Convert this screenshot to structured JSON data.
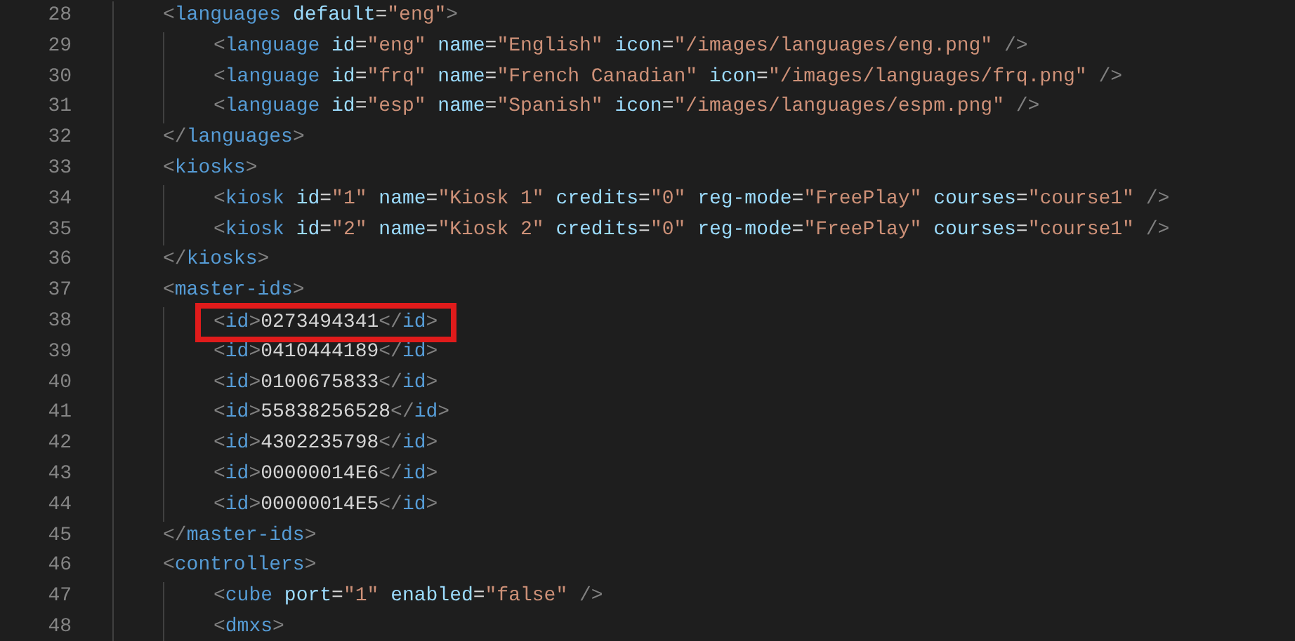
{
  "editor": {
    "lines": [
      {
        "number": "28",
        "highlighted": false,
        "tokens": [
          {
            "kind": "open",
            "text": "<"
          },
          {
            "kind": "tag",
            "text": "languages"
          },
          {
            "kind": "attr",
            "text": "default"
          },
          {
            "kind": "eq",
            "text": "="
          },
          {
            "kind": "value",
            "text": "\"eng\""
          },
          {
            "kind": "punct",
            "text": ">"
          }
        ],
        "children": [
          {
            "number": "29",
            "highlighted": false,
            "tokens": [
              {
                "kind": "open",
                "text": "<"
              },
              {
                "kind": "tag",
                "text": "language"
              },
              {
                "kind": "attr",
                "text": "id"
              },
              {
                "kind": "eq",
                "text": "="
              },
              {
                "kind": "value",
                "text": "\"eng\""
              },
              {
                "kind": "attr",
                "text": "name"
              },
              {
                "kind": "eq",
                "text": "="
              },
              {
                "kind": "value",
                "text": "\"English\""
              },
              {
                "kind": "attr",
                "text": "icon"
              },
              {
                "kind": "eq",
                "text": "="
              },
              {
                "kind": "value",
                "text": "\"/images/languages/eng.png\""
              },
              {
                "kind": "selfclose",
                "text": "/>"
              }
            ]
          },
          {
            "number": "30",
            "highlighted": false,
            "tokens": [
              {
                "kind": "open",
                "text": "<"
              },
              {
                "kind": "tag",
                "text": "language"
              },
              {
                "kind": "attr",
                "text": "id"
              },
              {
                "kind": "eq",
                "text": "="
              },
              {
                "kind": "value",
                "text": "\"frq\""
              },
              {
                "kind": "attr",
                "text": "name"
              },
              {
                "kind": "eq",
                "text": "="
              },
              {
                "kind": "value",
                "text": "\"French Canadian\""
              },
              {
                "kind": "attr",
                "text": "icon"
              },
              {
                "kind": "eq",
                "text": "="
              },
              {
                "kind": "value",
                "text": "\"/images/languages/frq.png\""
              },
              {
                "kind": "selfclose",
                "text": "/>"
              }
            ]
          },
          {
            "number": "31",
            "highlighted": false,
            "tokens": [
              {
                "kind": "open",
                "text": "<"
              },
              {
                "kind": "tag",
                "text": "language"
              },
              {
                "kind": "attr",
                "text": "id"
              },
              {
                "kind": "eq",
                "text": "="
              },
              {
                "kind": "value",
                "text": "\"esp\""
              },
              {
                "kind": "attr",
                "text": "name"
              },
              {
                "kind": "eq",
                "text": "="
              },
              {
                "kind": "value",
                "text": "\"Spanish\""
              },
              {
                "kind": "attr",
                "text": "icon"
              },
              {
                "kind": "eq",
                "text": "="
              },
              {
                "kind": "value",
                "text": "\"/images/languages/espm.png\""
              },
              {
                "kind": "selfclose",
                "text": "/>"
              }
            ]
          }
        ]
      },
      {
        "number": "32",
        "highlighted": false,
        "tokens": [
          {
            "kind": "open",
            "text": "</"
          },
          {
            "kind": "tag",
            "text": "languages"
          },
          {
            "kind": "punct",
            "text": ">"
          }
        ]
      },
      {
        "number": "33",
        "highlighted": false,
        "tokens": [
          {
            "kind": "open",
            "text": "<"
          },
          {
            "kind": "tag",
            "text": "kiosks"
          },
          {
            "kind": "punct",
            "text": ">"
          }
        ],
        "children": [
          {
            "number": "34",
            "highlighted": false,
            "tokens": [
              {
                "kind": "open",
                "text": "<"
              },
              {
                "kind": "tag",
                "text": "kiosk"
              },
              {
                "kind": "attr",
                "text": "id"
              },
              {
                "kind": "eq",
                "text": "="
              },
              {
                "kind": "value",
                "text": "\"1\""
              },
              {
                "kind": "attr",
                "text": "name"
              },
              {
                "kind": "eq",
                "text": "="
              },
              {
                "kind": "value",
                "text": "\"Kiosk 1\""
              },
              {
                "kind": "attr",
                "text": "credits"
              },
              {
                "kind": "eq",
                "text": "="
              },
              {
                "kind": "value",
                "text": "\"0\""
              },
              {
                "kind": "attr",
                "text": "reg-mode"
              },
              {
                "kind": "eq",
                "text": "="
              },
              {
                "kind": "value",
                "text": "\"FreePlay\""
              },
              {
                "kind": "attr",
                "text": "courses"
              },
              {
                "kind": "eq",
                "text": "="
              },
              {
                "kind": "value",
                "text": "\"course1\""
              },
              {
                "kind": "selfclose",
                "text": "/>"
              }
            ]
          },
          {
            "number": "35",
            "highlighted": false,
            "tokens": [
              {
                "kind": "open",
                "text": "<"
              },
              {
                "kind": "tag",
                "text": "kiosk"
              },
              {
                "kind": "attr",
                "text": "id"
              },
              {
                "kind": "eq",
                "text": "="
              },
              {
                "kind": "value",
                "text": "\"2\""
              },
              {
                "kind": "attr",
                "text": "name"
              },
              {
                "kind": "eq",
                "text": "="
              },
              {
                "kind": "value",
                "text": "\"Kiosk 2\""
              },
              {
                "kind": "attr",
                "text": "credits"
              },
              {
                "kind": "eq",
                "text": "="
              },
              {
                "kind": "value",
                "text": "\"0\""
              },
              {
                "kind": "attr",
                "text": "reg-mode"
              },
              {
                "kind": "eq",
                "text": "="
              },
              {
                "kind": "value",
                "text": "\"FreePlay\""
              },
              {
                "kind": "attr",
                "text": "courses"
              },
              {
                "kind": "eq",
                "text": "="
              },
              {
                "kind": "value",
                "text": "\"course1\""
              },
              {
                "kind": "selfclose",
                "text": "/>"
              }
            ]
          }
        ]
      },
      {
        "number": "36",
        "highlighted": false,
        "tokens": [
          {
            "kind": "open",
            "text": "</"
          },
          {
            "kind": "tag",
            "text": "kiosks"
          },
          {
            "kind": "punct",
            "text": ">"
          }
        ]
      },
      {
        "number": "37",
        "highlighted": false,
        "tokens": [
          {
            "kind": "open",
            "text": "<"
          },
          {
            "kind": "tag",
            "text": "master-ids"
          },
          {
            "kind": "punct",
            "text": ">"
          }
        ],
        "children": [
          {
            "number": "38",
            "highlighted": true,
            "tokens": [
              {
                "kind": "open",
                "text": "<"
              },
              {
                "kind": "tag",
                "text": "id"
              },
              {
                "kind": "punct",
                "text": ">"
              },
              {
                "kind": "text",
                "text": "0273494341"
              },
              {
                "kind": "punct",
                "text": "</"
              },
              {
                "kind": "tag",
                "text": "id"
              },
              {
                "kind": "punct",
                "text": ">"
              }
            ]
          },
          {
            "number": "39",
            "highlighted": false,
            "tokens": [
              {
                "kind": "open",
                "text": "<"
              },
              {
                "kind": "tag",
                "text": "id"
              },
              {
                "kind": "punct",
                "text": ">"
              },
              {
                "kind": "text",
                "text": "0410444189"
              },
              {
                "kind": "punct",
                "text": "</"
              },
              {
                "kind": "tag",
                "text": "id"
              },
              {
                "kind": "punct",
                "text": ">"
              }
            ]
          },
          {
            "number": "40",
            "highlighted": false,
            "tokens": [
              {
                "kind": "open",
                "text": "<"
              },
              {
                "kind": "tag",
                "text": "id"
              },
              {
                "kind": "punct",
                "text": ">"
              },
              {
                "kind": "text",
                "text": "0100675833"
              },
              {
                "kind": "punct",
                "text": "</"
              },
              {
                "kind": "tag",
                "text": "id"
              },
              {
                "kind": "punct",
                "text": ">"
              }
            ]
          },
          {
            "number": "41",
            "highlighted": false,
            "tokens": [
              {
                "kind": "open",
                "text": "<"
              },
              {
                "kind": "tag",
                "text": "id"
              },
              {
                "kind": "punct",
                "text": ">"
              },
              {
                "kind": "text",
                "text": "55838256528"
              },
              {
                "kind": "punct",
                "text": "</"
              },
              {
                "kind": "tag",
                "text": "id"
              },
              {
                "kind": "punct",
                "text": ">"
              }
            ]
          },
          {
            "number": "42",
            "highlighted": false,
            "tokens": [
              {
                "kind": "open",
                "text": "<"
              },
              {
                "kind": "tag",
                "text": "id"
              },
              {
                "kind": "punct",
                "text": ">"
              },
              {
                "kind": "text",
                "text": "4302235798"
              },
              {
                "kind": "punct",
                "text": "</"
              },
              {
                "kind": "tag",
                "text": "id"
              },
              {
                "kind": "punct",
                "text": ">"
              }
            ]
          },
          {
            "number": "43",
            "highlighted": false,
            "tokens": [
              {
                "kind": "open",
                "text": "<"
              },
              {
                "kind": "tag",
                "text": "id"
              },
              {
                "kind": "punct",
                "text": ">"
              },
              {
                "kind": "text",
                "text": "00000014E6"
              },
              {
                "kind": "punct",
                "text": "</"
              },
              {
                "kind": "tag",
                "text": "id"
              },
              {
                "kind": "punct",
                "text": ">"
              }
            ]
          },
          {
            "number": "44",
            "highlighted": false,
            "tokens": [
              {
                "kind": "open",
                "text": "<"
              },
              {
                "kind": "tag",
                "text": "id"
              },
              {
                "kind": "punct",
                "text": ">"
              },
              {
                "kind": "text",
                "text": "00000014E5"
              },
              {
                "kind": "punct",
                "text": "</"
              },
              {
                "kind": "tag",
                "text": "id"
              },
              {
                "kind": "punct",
                "text": ">"
              }
            ]
          }
        ]
      },
      {
        "number": "45",
        "highlighted": false,
        "tokens": [
          {
            "kind": "open",
            "text": "</"
          },
          {
            "kind": "tag",
            "text": "master-ids"
          },
          {
            "kind": "punct",
            "text": ">"
          }
        ]
      },
      {
        "number": "46",
        "highlighted": false,
        "tokens": [
          {
            "kind": "open",
            "text": "<"
          },
          {
            "kind": "tag",
            "text": "controllers"
          },
          {
            "kind": "punct",
            "text": ">"
          }
        ],
        "children": [
          {
            "number": "47",
            "highlighted": false,
            "tokens": [
              {
                "kind": "open",
                "text": "<"
              },
              {
                "kind": "tag",
                "text": "cube"
              },
              {
                "kind": "attr",
                "text": "port"
              },
              {
                "kind": "eq",
                "text": "="
              },
              {
                "kind": "value",
                "text": "\"1\""
              },
              {
                "kind": "attr",
                "text": "enabled"
              },
              {
                "kind": "eq",
                "text": "="
              },
              {
                "kind": "value",
                "text": "\"false\""
              },
              {
                "kind": "selfclose",
                "text": "/>"
              }
            ]
          },
          {
            "number": "48",
            "highlighted": false,
            "tokens": [
              {
                "kind": "open",
                "text": "<"
              },
              {
                "kind": "tag",
                "text": "dmxs"
              },
              {
                "kind": "punct",
                "text": ">"
              }
            ]
          }
        ]
      }
    ]
  }
}
